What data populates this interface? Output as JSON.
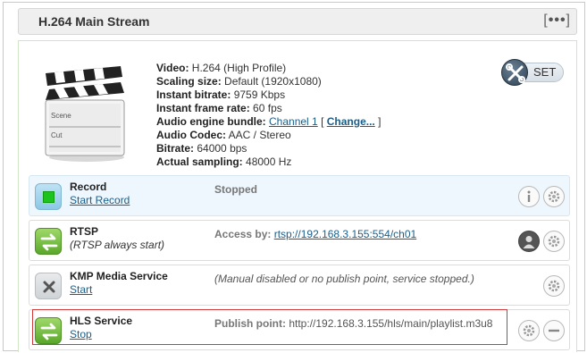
{
  "header": {
    "title": "H.264 Main Stream",
    "menu_left": "[",
    "menu_dots": "•••",
    "menu_right": "]"
  },
  "clapper": {
    "scene_label": "Scene",
    "cut_label": "Cut"
  },
  "info": {
    "video_label": "Video:",
    "video_value": "H.264 (High Profile)",
    "scaling_label": "Scaling size:",
    "scaling_value": "Default (1920x1080)",
    "bitrate_inst_label": "Instant bitrate:",
    "bitrate_inst_value": "9759 Kbps",
    "framerate_label": "Instant frame rate:",
    "framerate_value": "60 fps",
    "audio_bundle_label": "Audio engine bundle:",
    "audio_bundle_link": "Channel 1",
    "open_bracket": "[",
    "change_link": "Change...",
    "close_bracket": "]",
    "audio_codec_label": "Audio Codec:",
    "audio_codec_value": "AAC / Stereo",
    "bitrate_label": "Bitrate:",
    "bitrate_value": "64000 bps",
    "sampling_label": "Actual sampling:",
    "sampling_value": "48000 Hz"
  },
  "set_button": {
    "label": "SET"
  },
  "services": [
    {
      "name": "Record",
      "action": "Start Record",
      "status": "Stopped"
    },
    {
      "name": "RTSP",
      "note": "(RTSP always start)",
      "status_label": "Access by:",
      "status_link": "rtsp://192.168.3.155:554/ch01"
    },
    {
      "name": "KMP Media Service",
      "action": "Start",
      "status": "(Manual disabled or no publish point, service stopped.)"
    },
    {
      "name": "HLS Service",
      "action": "Stop",
      "status_label": "Publish point:",
      "status_value": "http://192.168.3.155/hls/main/playlist.m3u8"
    }
  ],
  "colors": {
    "highlight_border": "#d23a3a",
    "link": "#1a5e8a",
    "record_active_bg": "#eef7fd",
    "panel_border": "#cfe5c4"
  }
}
